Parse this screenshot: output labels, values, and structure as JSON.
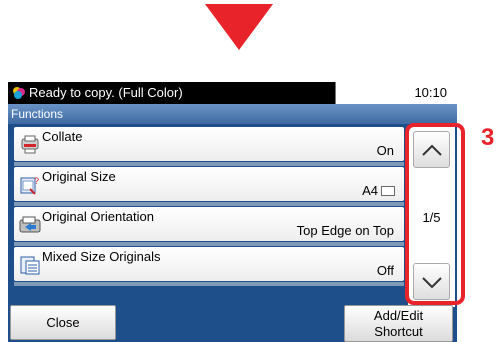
{
  "status": {
    "message": "Ready to copy. (Full Color)",
    "time": "10:10"
  },
  "title": "Functions",
  "items": [
    {
      "name": "Collate",
      "value": "On",
      "icon": "collate-icon"
    },
    {
      "name": "Original Size",
      "value": "A4",
      "icon": "original-size-icon"
    },
    {
      "name": "Original Orientation",
      "value": "Top Edge on Top",
      "icon": "original-orientation-icon"
    },
    {
      "name": "Mixed Size Originals",
      "value": "Off",
      "icon": "mixed-size-originals-icon"
    }
  ],
  "scroll": {
    "page": "1/5",
    "up_icon": "chevron-up-icon",
    "down_icon": "chevron-down-icon"
  },
  "callout": "3",
  "buttons": {
    "close": "Close",
    "add_edit_shortcut_line1": "Add/Edit",
    "add_edit_shortcut_line2": "Shortcut"
  },
  "colors": {
    "accent_red": "#e8242a",
    "panel_blue": "#1f4f8a",
    "title_blue": "#5a86bb"
  }
}
